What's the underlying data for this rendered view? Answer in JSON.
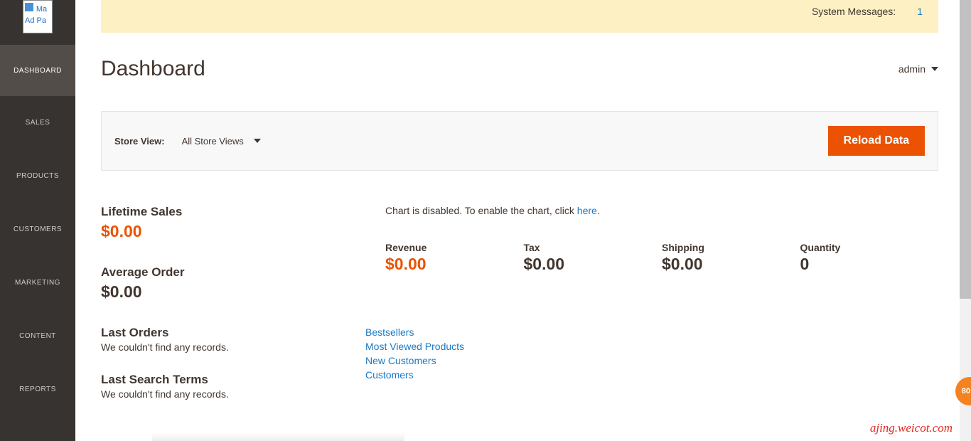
{
  "logo_alt": "Ma\nAd\nPa",
  "sidebar": {
    "items": [
      {
        "label": "DASHBOARD",
        "active": true
      },
      {
        "label": "SALES"
      },
      {
        "label": "PRODUCTS"
      },
      {
        "label": "CUSTOMERS"
      },
      {
        "label": "MARKETING"
      },
      {
        "label": "CONTENT"
      },
      {
        "label": "REPORTS"
      }
    ]
  },
  "system_messages": {
    "label": "System Messages:",
    "count": "1"
  },
  "page_title": "Dashboard",
  "user": "admin",
  "toolbar": {
    "store_view_label": "Store View:",
    "store_view_value": "All Store Views",
    "reload_label": "Reload Data"
  },
  "stats": {
    "lifetime_sales": {
      "label": "Lifetime Sales",
      "value": "$0.00"
    },
    "average_order": {
      "label": "Average Order",
      "value": "$0.00"
    }
  },
  "sections": {
    "last_orders": {
      "title": "Last Orders",
      "empty": "We couldn't find any records."
    },
    "last_search": {
      "title": "Last Search Terms",
      "empty": "We couldn't find any records."
    }
  },
  "chart_message": {
    "before": "Chart is disabled. To enable the chart, click ",
    "link": "here",
    "after": "."
  },
  "metrics": {
    "revenue": {
      "label": "Revenue",
      "value": "$0.00"
    },
    "tax": {
      "label": "Tax",
      "value": "$0.00"
    },
    "shipping": {
      "label": "Shipping",
      "value": "$0.00"
    },
    "quantity": {
      "label": "Quantity",
      "value": "0"
    }
  },
  "tab_links": [
    "Bestsellers",
    "Most Viewed Products",
    "New Customers",
    "Customers"
  ],
  "watermark": "ajing.weicot.com",
  "badge": "80"
}
